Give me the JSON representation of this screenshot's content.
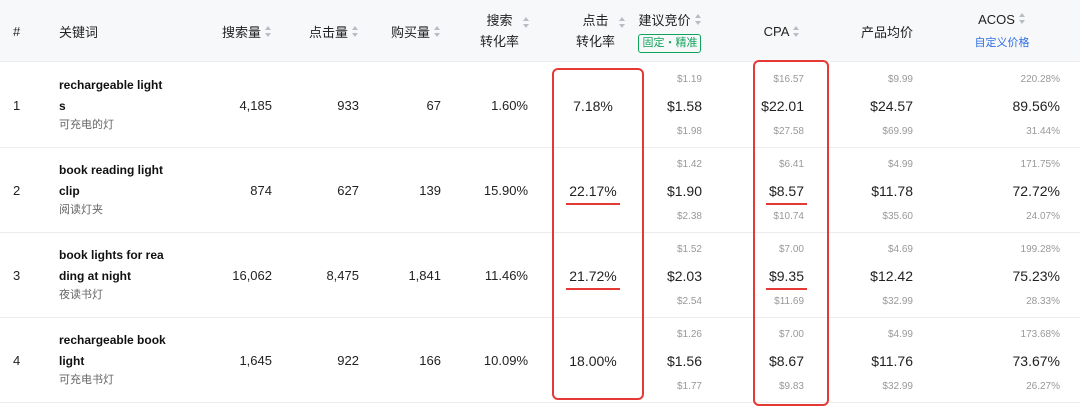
{
  "columns": {
    "index": "#",
    "keyword": "关键词",
    "search_volume": "搜索量",
    "clicks": "点击量",
    "purchases": "购买量",
    "search_cvr_l1": "搜索",
    "search_cvr_l2": "转化率",
    "click_cvr_l1": "点击",
    "click_cvr_l2": "转化率",
    "bid": "建议竞价",
    "bid_badge": "固定・精准",
    "cpa": "CPA",
    "avg_price": "产品均价",
    "acos": "ACOS",
    "acos_link": "自定义价格"
  },
  "rows": [
    {
      "index": "1",
      "keyword": "rechargeable light s",
      "keyword_cn": "可充电的灯",
      "search_volume": "4,185",
      "clicks": "933",
      "purchases": "67",
      "search_cvr": "1.60%",
      "click_cvr": "7.18%",
      "bid_low": "$1.19",
      "bid_mid": "$1.58",
      "bid_high": "$1.98",
      "cpa_low": "$16.57",
      "cpa_mid": "$22.01",
      "cpa_high": "$27.58",
      "price_low": "$9.99",
      "price_mid": "$24.57",
      "price_high": "$69.99",
      "acos_high": "220.28%",
      "acos_mid": "89.56%",
      "acos_low": "31.44%"
    },
    {
      "index": "2",
      "keyword": "book reading light clip",
      "keyword_cn": "阅读灯夹",
      "search_volume": "874",
      "clicks": "627",
      "purchases": "139",
      "search_cvr": "15.90%",
      "click_cvr": "22.17%",
      "bid_low": "$1.42",
      "bid_mid": "$1.90",
      "bid_high": "$2.38",
      "cpa_low": "$6.41",
      "cpa_mid": "$8.57",
      "cpa_high": "$10.74",
      "price_low": "$4.99",
      "price_mid": "$11.78",
      "price_high": "$35.60",
      "acos_high": "171.75%",
      "acos_mid": "72.72%",
      "acos_low": "24.07%"
    },
    {
      "index": "3",
      "keyword": "book lights for rea ding at night",
      "keyword_cn": "夜读书灯",
      "search_volume": "16,062",
      "clicks": "8,475",
      "purchases": "1,841",
      "search_cvr": "11.46%",
      "click_cvr": "21.72%",
      "bid_low": "$1.52",
      "bid_mid": "$2.03",
      "bid_high": "$2.54",
      "cpa_low": "$7.00",
      "cpa_mid": "$9.35",
      "cpa_high": "$11.69",
      "price_low": "$4.69",
      "price_mid": "$12.42",
      "price_high": "$32.99",
      "acos_high": "199.28%",
      "acos_mid": "75.23%",
      "acos_low": "28.33%"
    },
    {
      "index": "4",
      "keyword": "rechargeable book light",
      "keyword_cn": "可充电书灯",
      "search_volume": "1,645",
      "clicks": "922",
      "purchases": "166",
      "search_cvr": "10.09%",
      "click_cvr": "18.00%",
      "bid_low": "$1.26",
      "bid_mid": "$1.56",
      "bid_high": "$1.77",
      "cpa_low": "$7.00",
      "cpa_mid": "$8.67",
      "cpa_high": "$9.83",
      "price_low": "$4.99",
      "price_mid": "$11.76",
      "price_high": "$32.99",
      "acos_high": "173.68%",
      "acos_mid": "73.67%",
      "acos_low": "26.27%"
    }
  ],
  "colors": {
    "highlight": "#e53935",
    "badge_green": "#11a35b",
    "link_blue": "#2f6fe4",
    "header_bg": "#f7f8fa"
  }
}
